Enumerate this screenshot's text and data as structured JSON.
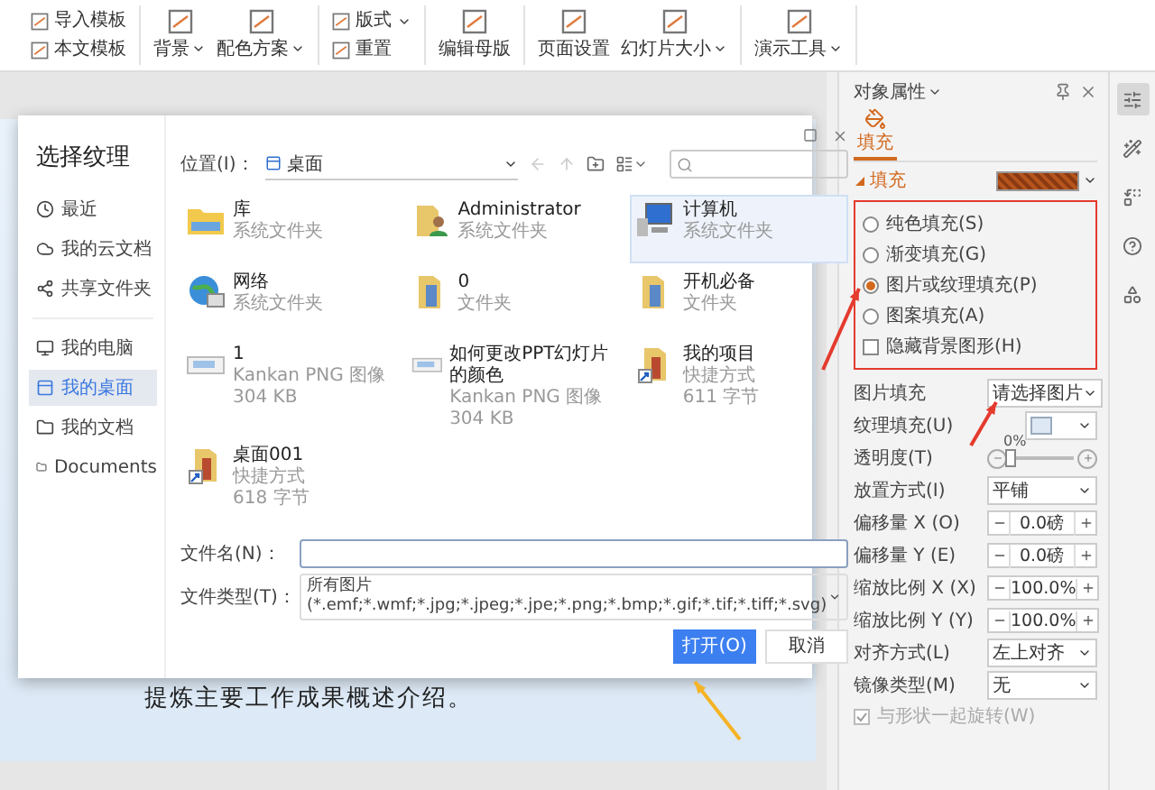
{
  "ribbon": [
    {
      "items": [
        {
          "label": "导入模板",
          "kind": "small",
          "dropdown": false
        },
        {
          "label": "本文模板",
          "kind": "small",
          "dropdown": false
        }
      ]
    },
    {
      "items": [
        {
          "label": "背景",
          "kind": "large",
          "dropdown": true
        },
        {
          "label": "配色方案",
          "kind": "large",
          "dropdown": true
        }
      ]
    },
    {
      "items": [
        {
          "label": "版式",
          "kind": "small",
          "dropdown": true
        },
        {
          "label": "重置",
          "kind": "small",
          "dropdown": false
        }
      ]
    },
    {
      "items": [
        {
          "label": "编辑母版",
          "kind": "large",
          "dropdown": false
        }
      ]
    },
    {
      "items": [
        {
          "label": "页面设置",
          "kind": "large",
          "dropdown": false
        },
        {
          "label": "幻灯片大小",
          "kind": "large",
          "dropdown": true
        }
      ]
    },
    {
      "items": [
        {
          "label": "演示工具",
          "kind": "large",
          "dropdown": true
        }
      ]
    }
  ],
  "slide": {
    "text": "提炼主要工作成果概述介绍。"
  },
  "dialog": {
    "title": "选择纹理",
    "places": [
      {
        "label": "最近",
        "selected": false
      },
      {
        "label": "我的云文档",
        "selected": false
      },
      {
        "label": "共享文件夹",
        "selected": false
      }
    ],
    "locations": [
      {
        "label": "我的电脑",
        "selected": false
      },
      {
        "label": "我的桌面",
        "selected": true
      },
      {
        "label": "我的文档",
        "selected": false
      },
      {
        "label": "Documents",
        "selected": false
      }
    ],
    "location_label": "位置(I)：",
    "location": "桌面",
    "files": [
      {
        "name": "库",
        "details": [
          "系统文件夹"
        ],
        "kind": "library",
        "selected": false
      },
      {
        "name": "Administrator",
        "details": [
          "系统文件夹"
        ],
        "kind": "user",
        "selected": false
      },
      {
        "name": "计算机",
        "details": [
          "系统文件夹"
        ],
        "kind": "computer",
        "selected": true
      },
      {
        "name": "网络",
        "details": [
          "系统文件夹"
        ],
        "kind": "network",
        "selected": false
      },
      {
        "name": "0",
        "details": [
          "文件夹"
        ],
        "kind": "folder",
        "selected": false
      },
      {
        "name": "开机必备",
        "details": [
          "文件夹"
        ],
        "kind": "folder",
        "selected": false
      },
      {
        "name": "1",
        "details": [
          "Kankan PNG 图像",
          "304 KB"
        ],
        "kind": "image",
        "selected": false
      },
      {
        "name": "如何更改PPT幻灯片的颜色",
        "details": [
          "Kankan PNG 图像",
          "304 KB"
        ],
        "kind": "image",
        "selected": false
      },
      {
        "name": "我的项目",
        "details": [
          "快捷方式",
          "611 字节"
        ],
        "kind": "shortcut",
        "selected": false
      },
      {
        "name": "桌面001",
        "details": [
          "快捷方式",
          "618 字节"
        ],
        "kind": "shortcut",
        "selected": false
      }
    ],
    "filename_label": "文件名(N)：",
    "filetype_label": "文件类型(T)：",
    "filetype": "所有图片 (*.emf;*.wmf;*.jpg;*.jpeg;*.jpe;*.png;*.bmp;*.gif;*.tif;*.tiff;*.svg)",
    "buttons": [
      {
        "label": "打开(O)",
        "kind": "primary"
      },
      {
        "label": "取消",
        "kind": "secondary"
      }
    ]
  },
  "panel": {
    "title": "对象属性",
    "tabs": [
      {
        "label": "填充",
        "selected": true
      }
    ],
    "section": {
      "label": "填充",
      "expanded": true
    },
    "fill_options": [
      {
        "label": "纯色填充(S)",
        "kind": "radio",
        "selected": false
      },
      {
        "label": "渐变填充(G)",
        "kind": "radio",
        "selected": false
      },
      {
        "label": "图片或纹理填充(P)",
        "kind": "radio",
        "selected": true
      },
      {
        "label": "图案填充(A)",
        "kind": "radio",
        "selected": false
      },
      {
        "label": "隐藏背景图形(H)",
        "kind": "checkbox",
        "checked": false
      }
    ],
    "properties": [
      {
        "label": "图片填充",
        "kind": "select",
        "value": "请选择图片"
      },
      {
        "label": "纹理填充(U)",
        "kind": "texture"
      },
      {
        "label": "透明度(T)",
        "kind": "slider",
        "level": 0,
        "reading": "0%"
      },
      {
        "label": "放置方式(I)",
        "kind": "select",
        "value": "平铺"
      },
      {
        "label": "偏移量 X (O)",
        "kind": "stepper",
        "value": "0.0磅"
      },
      {
        "label": "偏移量 Y (E)",
        "kind": "stepper",
        "value": "0.0磅"
      },
      {
        "label": "缩放比例 X (X)",
        "kind": "stepper",
        "value": "100.0%"
      },
      {
        "label": "缩放比例 Y (Y)",
        "kind": "stepper",
        "value": "100.0%"
      },
      {
        "label": "对齐方式(L)",
        "kind": "select",
        "value": "左上对齐"
      },
      {
        "label": "镜像类型(M)",
        "kind": "select",
        "value": "无"
      }
    ],
    "rotate_option": {
      "label": "与形状一起旋转(W)",
      "checked": true,
      "disabled": true
    }
  }
}
